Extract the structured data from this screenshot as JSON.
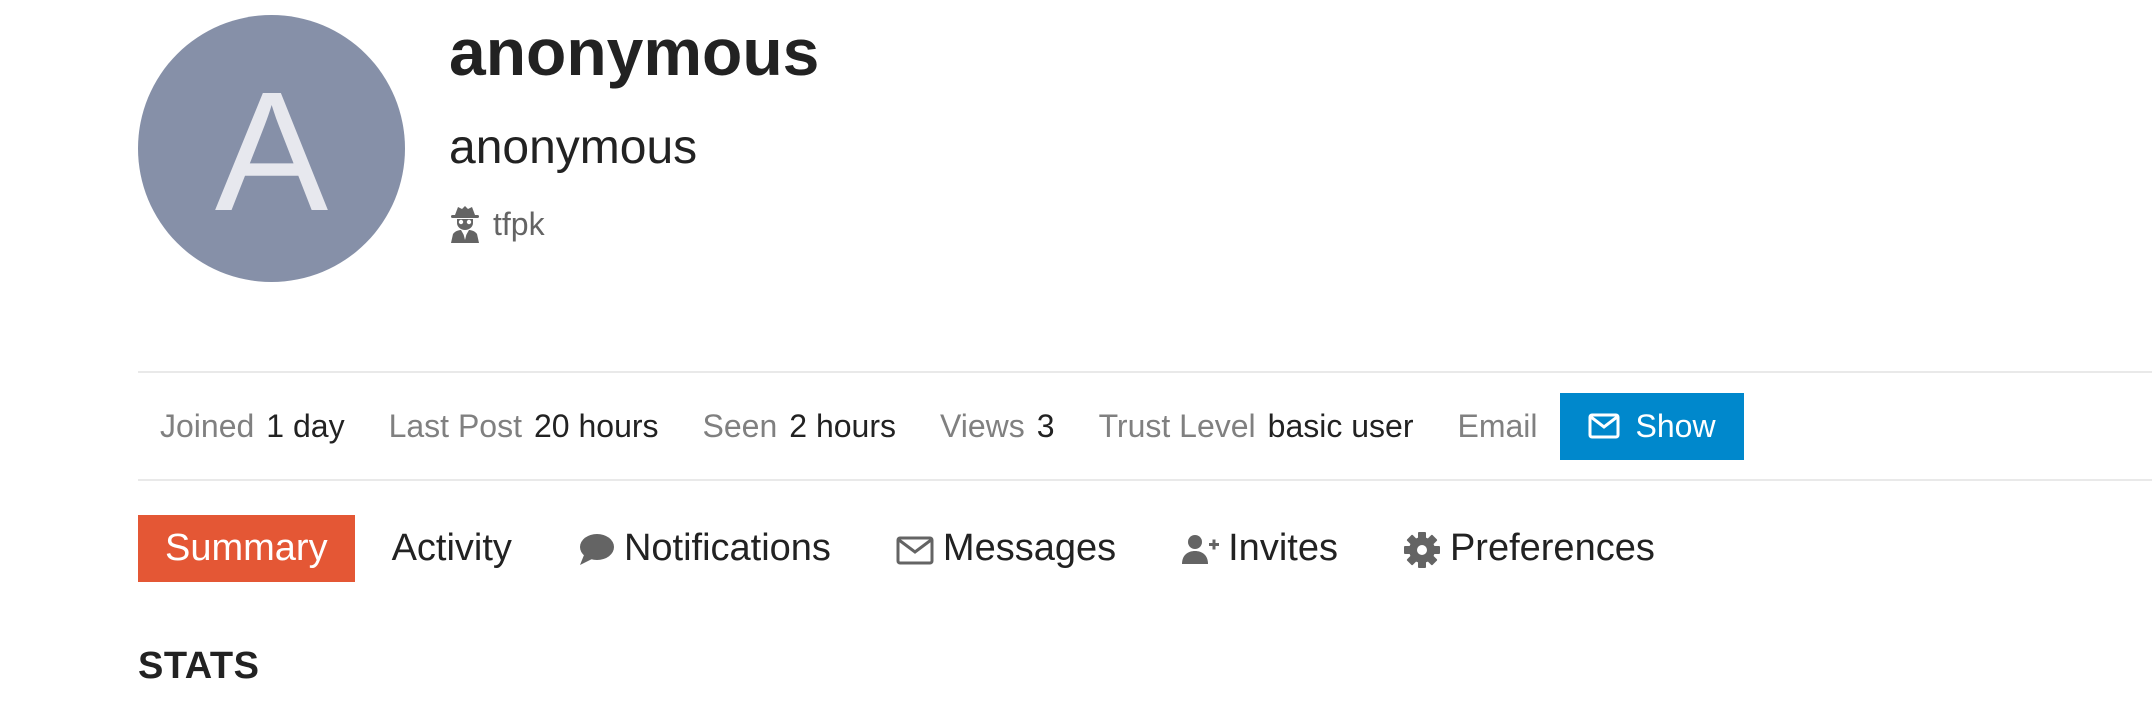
{
  "profile": {
    "avatar_letter": "A",
    "avatar_color": "#8690a8",
    "username": "anonymous",
    "full_name": "anonymous",
    "group_icon": "user-secret-icon",
    "group_name": "tfpk"
  },
  "stats_bar": {
    "joined": {
      "label": "Joined",
      "value": "1 day"
    },
    "last_post": {
      "label": "Last Post",
      "value": "20 hours"
    },
    "seen": {
      "label": "Seen",
      "value": "2 hours"
    },
    "views": {
      "label": "Views",
      "value": "3"
    },
    "trust_level": {
      "label": "Trust Level",
      "value": "basic user"
    },
    "email": {
      "label": "Email",
      "button_label": "Show",
      "button_icon": "envelope-icon"
    }
  },
  "nav": {
    "tabs": [
      {
        "label": "Summary",
        "active": true
      },
      {
        "label": "Activity",
        "active": false
      },
      {
        "label": "Notifications",
        "icon": "comment-icon",
        "active": false
      },
      {
        "label": "Messages",
        "icon": "envelope-icon",
        "active": false
      },
      {
        "label": "Invites",
        "icon": "user-plus-icon",
        "active": false
      },
      {
        "label": "Preferences",
        "icon": "gear-icon",
        "active": false
      }
    ]
  },
  "section": {
    "heading": "STATS"
  },
  "colors": {
    "accent_tab": "#e45735",
    "primary_button": "#0088cc",
    "muted_text": "#808080"
  }
}
